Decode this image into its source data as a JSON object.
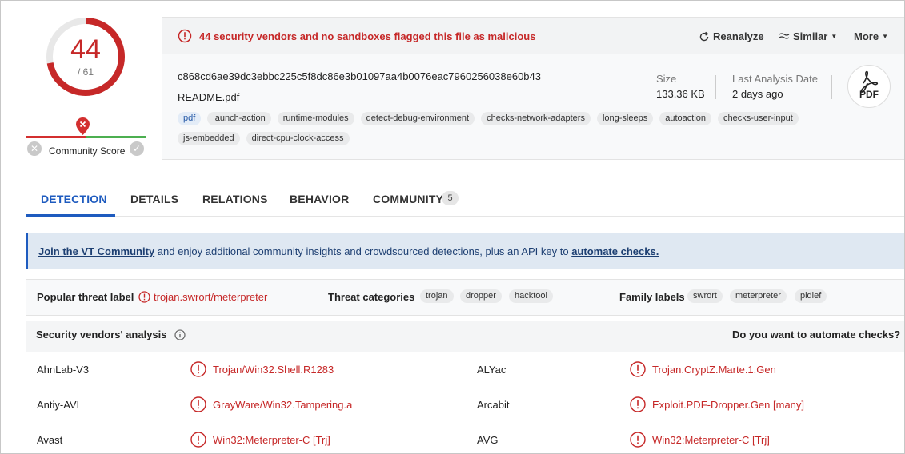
{
  "score": {
    "detections": "44",
    "total": "/ 61",
    "detection_ratio": 0.721
  },
  "community": {
    "label": "Community Score"
  },
  "alert": {
    "text": "44 security vendors and no sandboxes flagged this file as malicious"
  },
  "header_actions": {
    "reanalyze": "Reanalyze",
    "similar": "Similar",
    "more": "More"
  },
  "file": {
    "hash": "c868cd6ae39dc3ebbc225c5f8dc86e3b01097aa4b0076eac7960256038e60b43",
    "name": "README.pdf",
    "tags": [
      "pdf",
      "launch-action",
      "runtime-modules",
      "detect-debug-environment",
      "checks-network-adapters",
      "long-sleeps",
      "autoaction",
      "checks-user-input",
      "js-embedded",
      "direct-cpu-clock-access"
    ],
    "size_label": "Size",
    "size_value": "133.36 KB",
    "date_label": "Last Analysis Date",
    "date_value": "2 days ago",
    "type_icon_label": "PDF"
  },
  "tabs": [
    {
      "label": "DETECTION"
    },
    {
      "label": "DETAILS"
    },
    {
      "label": "RELATIONS"
    },
    {
      "label": "BEHAVIOR"
    },
    {
      "label": "COMMUNITY",
      "count": "5"
    }
  ],
  "banner": {
    "link1": "Join the VT Community",
    "middle": " and enjoy additional community insights and crowdsourced detections, plus an API key to ",
    "link2": "automate checks."
  },
  "threat": {
    "popular_label": "Popular threat label",
    "popular_value": "trojan.swrort/meterpreter",
    "categories_label": "Threat categories",
    "categories": [
      "trojan",
      "dropper",
      "hacktool"
    ],
    "family_label": "Family labels",
    "families": [
      "swrort",
      "meterpreter",
      "pidief"
    ]
  },
  "vendors": {
    "title": "Security vendors' analysis",
    "automate": "Do you want to automate checks?",
    "rows": [
      {
        "left_vendor": "AhnLab-V3",
        "left_result": "Trojan/Win32.Shell.R1283",
        "right_vendor": "ALYac",
        "right_result": "Trojan.CryptZ.Marte.1.Gen"
      },
      {
        "left_vendor": "Antiy-AVL",
        "left_result": "GrayWare/Win32.Tampering.a",
        "right_vendor": "Arcabit",
        "right_result": "Exploit.PDF-Dropper.Gen [many]"
      },
      {
        "left_vendor": "Avast",
        "left_result": "Win32:Meterpreter-C [Trj]",
        "right_vendor": "AVG",
        "right_result": "Win32:Meterpreter-C [Trj]"
      }
    ]
  },
  "colors": {
    "malicious": "#c62828",
    "accent": "#1e5bbf",
    "harmless": "#4caf50"
  }
}
